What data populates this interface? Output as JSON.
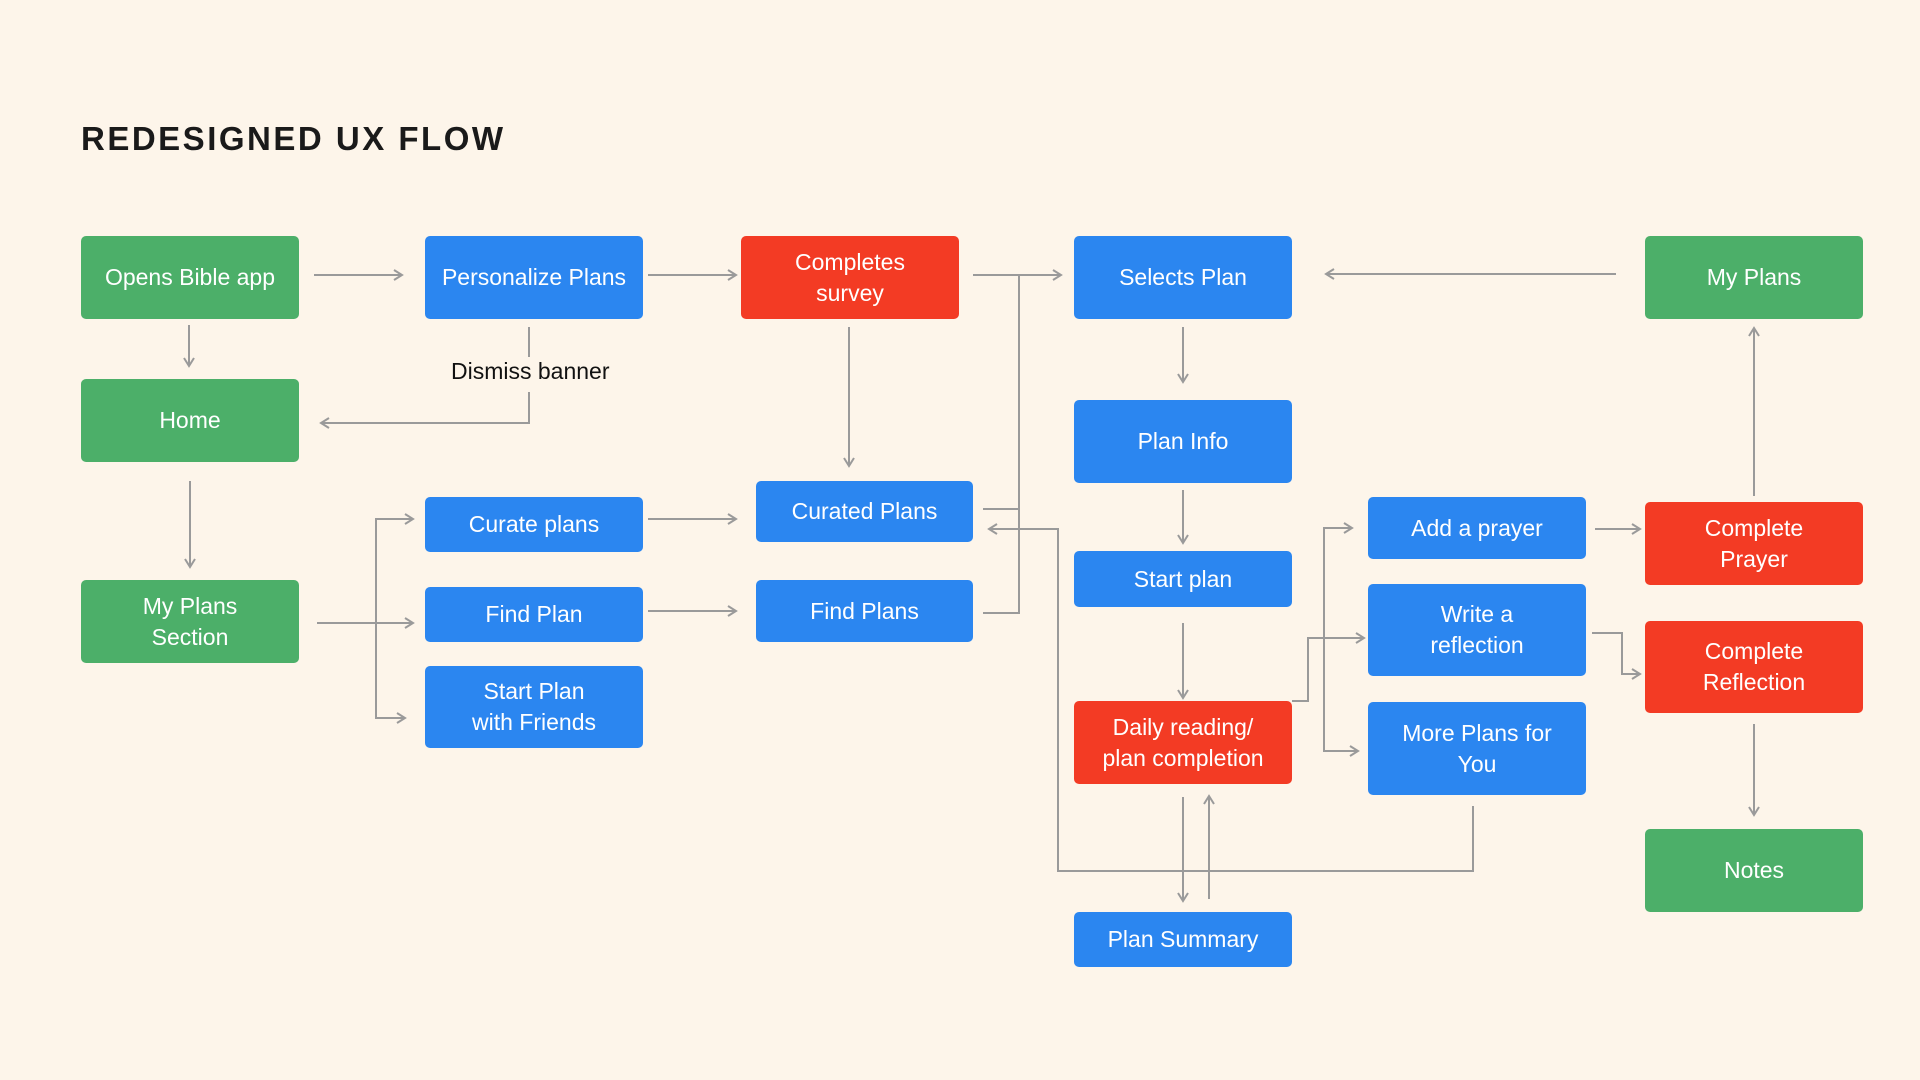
{
  "title": "REDESIGNED UX FLOW",
  "colors": {
    "background": "#fdf5ea",
    "entry_green": "#4caf69",
    "step_blue": "#2b86f0",
    "action_red": "#f33b24",
    "connector_gray": "#9a9a9a"
  },
  "nodes": {
    "opens_bible_app": {
      "label": "Opens Bible app",
      "type": "green"
    },
    "home": {
      "label": "Home",
      "type": "green"
    },
    "my_plans_section": {
      "label": "My Plans\nSection",
      "type": "green"
    },
    "personalize_plans": {
      "label": "Personalize Plans",
      "type": "blue"
    },
    "curate_plans": {
      "label": "Curate plans",
      "type": "blue"
    },
    "find_plan": {
      "label": "Find Plan",
      "type": "blue"
    },
    "start_plan_with_friends": {
      "label": "Start Plan\nwith Friends",
      "type": "blue"
    },
    "completes_survey": {
      "label": "Completes\nsurvey",
      "type": "red"
    },
    "curated_plans": {
      "label": "Curated Plans",
      "type": "blue"
    },
    "find_plans": {
      "label": "Find Plans",
      "type": "blue"
    },
    "selects_plan": {
      "label": "Selects Plan",
      "type": "blue"
    },
    "plan_info": {
      "label": "Plan Info",
      "type": "blue"
    },
    "start_plan": {
      "label": "Start plan",
      "type": "blue"
    },
    "daily_reading": {
      "label": "Daily reading/\nplan completion",
      "type": "red"
    },
    "plan_summary": {
      "label": "Plan Summary",
      "type": "blue"
    },
    "add_a_prayer": {
      "label": "Add a prayer",
      "type": "blue"
    },
    "write_a_reflection": {
      "label": "Write a\nreflection",
      "type": "blue"
    },
    "more_plans_for_you": {
      "label": "More Plans for\nYou",
      "type": "blue"
    },
    "my_plans": {
      "label": "My Plans",
      "type": "green"
    },
    "complete_prayer": {
      "label": "Complete\nPrayer",
      "type": "red"
    },
    "complete_reflection": {
      "label": "Complete\nReflection",
      "type": "red"
    },
    "notes": {
      "label": "Notes",
      "type": "green"
    }
  },
  "edge_labels": {
    "dismiss_banner": "Dismiss banner"
  },
  "edges": [
    {
      "from": "opens_bible_app",
      "to": "personalize_plans"
    },
    {
      "from": "opens_bible_app",
      "to": "home"
    },
    {
      "from": "personalize_plans",
      "to": "completes_survey"
    },
    {
      "from": "personalize_plans",
      "to": "home",
      "label": "Dismiss banner"
    },
    {
      "from": "home",
      "to": "my_plans_section"
    },
    {
      "from": "my_plans_section",
      "to": "curate_plans"
    },
    {
      "from": "my_plans_section",
      "to": "find_plan"
    },
    {
      "from": "my_plans_section",
      "to": "start_plan_with_friends"
    },
    {
      "from": "completes_survey",
      "to": "curated_plans"
    },
    {
      "from": "completes_survey",
      "to": "selects_plan"
    },
    {
      "from": "curate_plans",
      "to": "curated_plans"
    },
    {
      "from": "find_plan",
      "to": "find_plans"
    },
    {
      "from": "curated_plans",
      "to": "selects_plan"
    },
    {
      "from": "find_plans",
      "to": "selects_plan"
    },
    {
      "from": "my_plans",
      "to": "selects_plan"
    },
    {
      "from": "selects_plan",
      "to": "plan_info"
    },
    {
      "from": "plan_info",
      "to": "start_plan"
    },
    {
      "from": "start_plan",
      "to": "daily_reading"
    },
    {
      "from": "daily_reading",
      "to": "plan_summary"
    },
    {
      "from": "plan_summary",
      "to": "daily_reading"
    },
    {
      "from": "daily_reading",
      "to": "add_a_prayer"
    },
    {
      "from": "daily_reading",
      "to": "write_a_reflection"
    },
    {
      "from": "daily_reading",
      "to": "more_plans_for_you"
    },
    {
      "from": "more_plans_for_you",
      "to": "curated_plans"
    },
    {
      "from": "add_a_prayer",
      "to": "complete_prayer"
    },
    {
      "from": "write_a_reflection",
      "to": "complete_reflection"
    },
    {
      "from": "complete_prayer",
      "to": "my_plans"
    },
    {
      "from": "complete_reflection",
      "to": "notes"
    }
  ]
}
